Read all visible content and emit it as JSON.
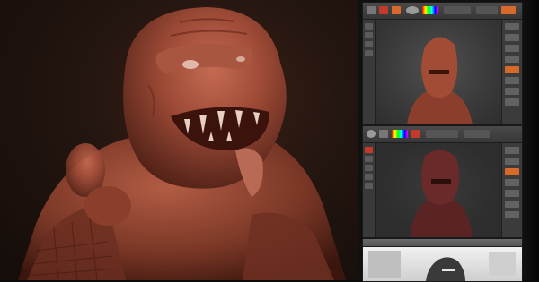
{
  "scene": {
    "main_render": {
      "subject": "sculpted-creature-bust",
      "material_color": "#9c4a36"
    },
    "editor_windows": [
      {
        "id": "editor-window-1",
        "viewport_color": "#3c3c3c",
        "model_color": "#a24c36"
      },
      {
        "id": "editor-window-2",
        "viewport_color": "#313131",
        "model_color": "#6a2a2a"
      },
      {
        "id": "editor-window-3",
        "viewport_color": "#e6e6e6",
        "model_color": "#3a3a3a"
      }
    ]
  },
  "colors": {
    "background": "#0b0a09",
    "ui_gray": "#2c2c2c",
    "accent_orange": "#d9682b",
    "accent_red": "#c43a2a"
  }
}
